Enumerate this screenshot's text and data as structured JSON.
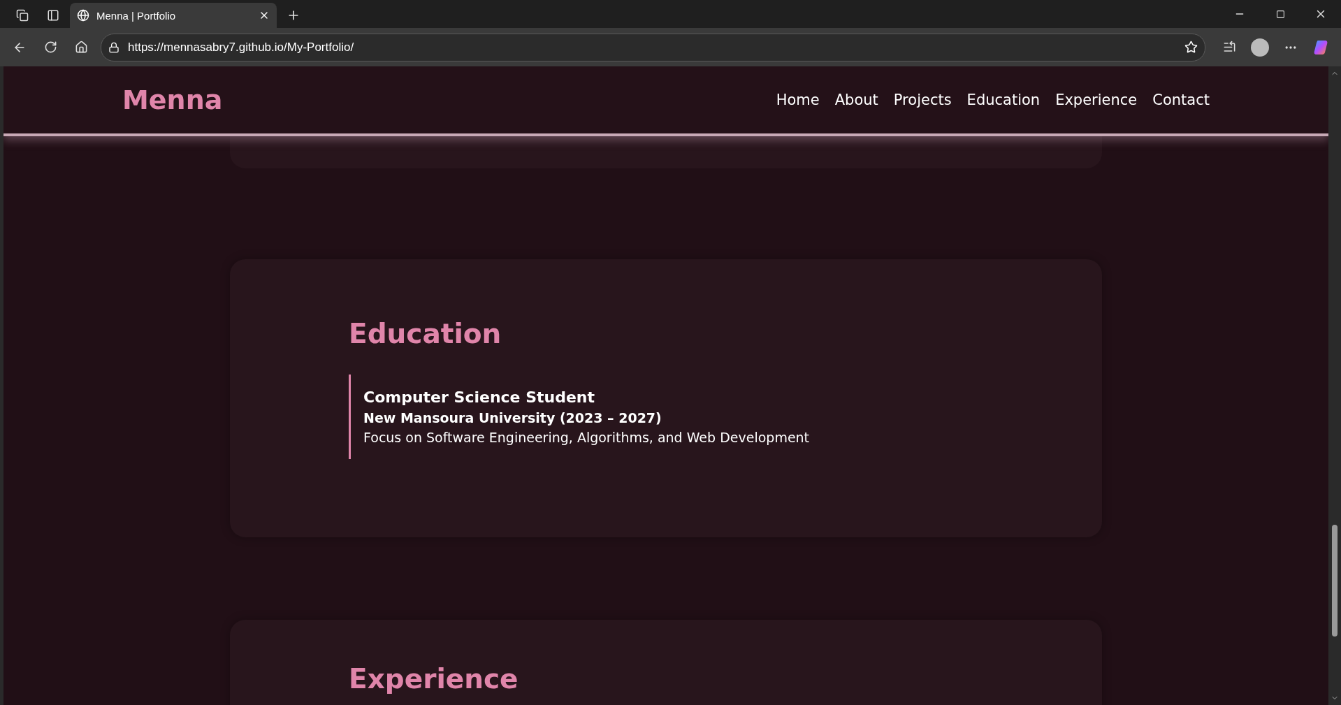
{
  "browser": {
    "tab_title": "Menna | Portfolio",
    "url": "https://mennasabry7.github.io/My-Portfolio/"
  },
  "nav": {
    "logo": "Menna",
    "links": [
      {
        "label": "Home"
      },
      {
        "label": "About"
      },
      {
        "label": "Projects"
      },
      {
        "label": "Education"
      },
      {
        "label": "Experience"
      },
      {
        "label": "Contact"
      }
    ]
  },
  "education": {
    "heading": "Education",
    "entries": [
      {
        "title": "Computer Science Student",
        "institution": "New Mansoura University (2023 – 2027)",
        "description": "Focus on Software Engineering, Algorithms, and Web Development"
      }
    ]
  },
  "experience": {
    "heading": "Experience"
  }
}
